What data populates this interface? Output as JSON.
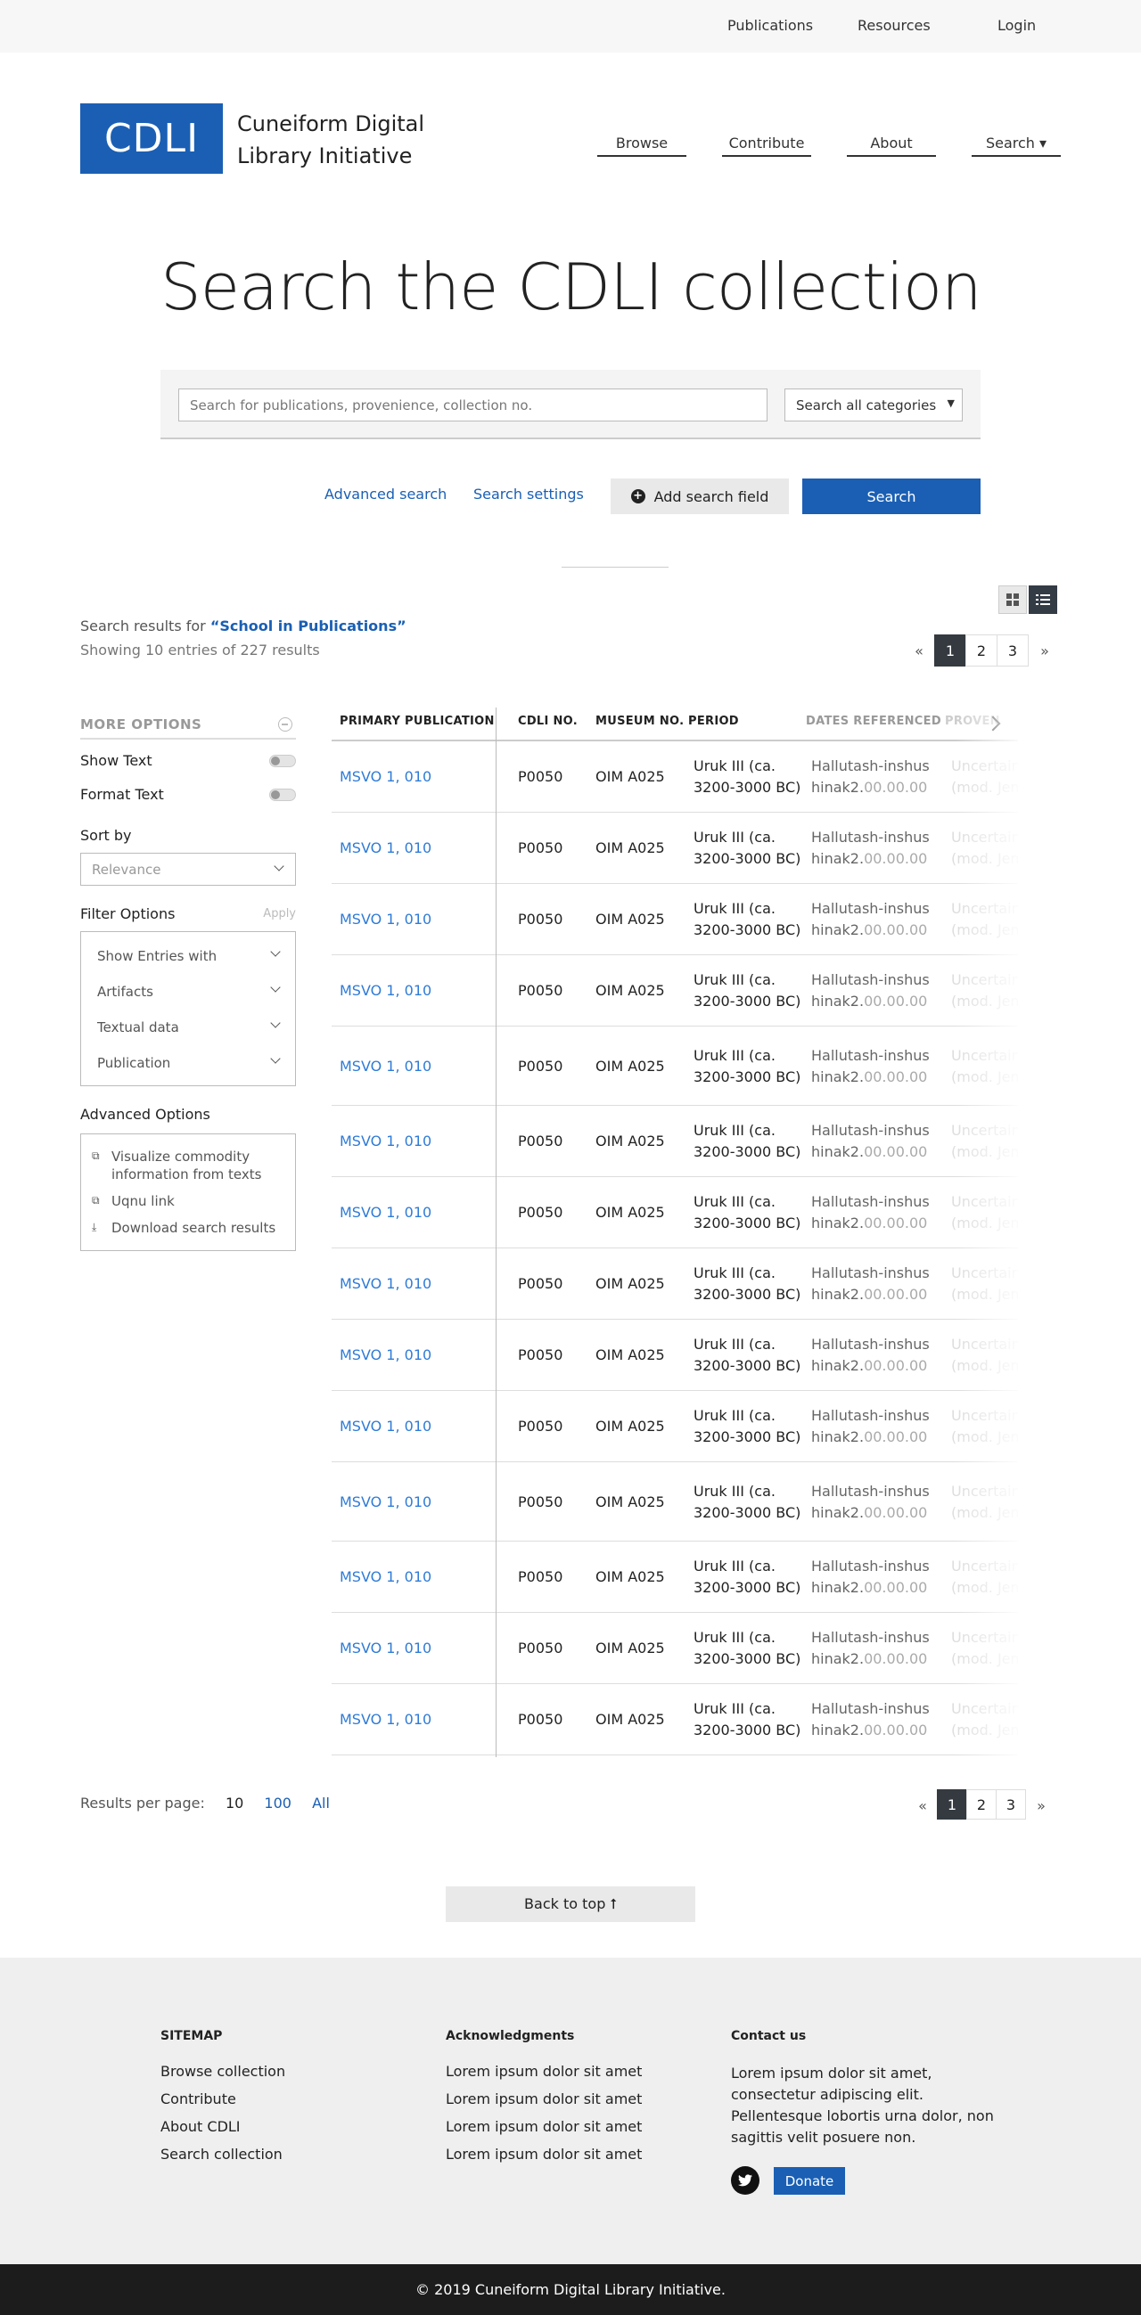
{
  "topbar": {
    "publications": "Publications",
    "resources": "Resources",
    "login": "Login"
  },
  "brand": {
    "logo": "CDLI",
    "name_line1": "Cuneiform Digital",
    "name_line2": "Library Initiative"
  },
  "nav": {
    "browse": "Browse",
    "contribute": "Contribute",
    "about": "About",
    "search": "Search ▾"
  },
  "page_title": "Search the CDLI collection",
  "search": {
    "placeholder": "Search for publications, provenience, collection no.",
    "category": "Search all categories",
    "advanced": "Advanced search",
    "settings": "Search settings",
    "add_field": "Add search field",
    "button": "Search"
  },
  "results": {
    "prefix": "Search results for ",
    "query": "“School in Publications”",
    "showing": "Showing 10 entries of 227 results"
  },
  "pagination": {
    "prev": "«",
    "pages": [
      "1",
      "2",
      "3"
    ],
    "next": "»"
  },
  "sidebar": {
    "more_options": "MORE OPTIONS",
    "show_text": "Show Text",
    "format_text": "Format Text",
    "sort_by": "Sort by",
    "sort_value": "Relevance",
    "filter_options": "Filter Options",
    "apply": "Apply",
    "filters": [
      "Show Entries with",
      "Artifacts",
      "Textual data",
      "Publication"
    ],
    "advanced_options": "Advanced Options",
    "advanced_items": [
      "Visualize commodity information from texts",
      "Uqnu link",
      "Download search results"
    ]
  },
  "table": {
    "headers": [
      "PRIMARY PUBLICATION",
      "CDLI NO.",
      "MUSEUM NO.",
      "PERIOD",
      "DATES REFERENCED",
      "PROVEN"
    ],
    "row": {
      "pub": "MSVO 1, 010",
      "cdli": "P0050",
      "museum": "OIM A025",
      "period_1": "Uruk III (ca.",
      "period_2": "3200-3000 BC)",
      "date_1": "Hallutash-inshus",
      "date_2a": "hinak2.",
      "date_2b": "00.00.00",
      "prov_1": "Uncertain",
      "prov_2": "(mod. Jem"
    }
  },
  "rpp": {
    "label": "Results per page:",
    "options": [
      "10",
      "100",
      "All"
    ]
  },
  "back_to_top": "Back to top ⭡",
  "footer": {
    "sitemap": "SITEMAP",
    "sitemap_links": [
      "Browse collection",
      "Contribute",
      "About CDLI",
      "Search collection"
    ],
    "ack": "Acknowledgments",
    "ack_links": [
      "Lorem ipsum dolor sit amet",
      "Lorem ipsum dolor sit amet",
      "Lorem ipsum dolor sit amet",
      "Lorem ipsum dolor sit amet"
    ],
    "contact": "Contact us",
    "contact_text": "Lorem ipsum dolor sit amet, consectetur adipiscing elit. Pellentesque lobortis urna dolor, non sagittis velit posuere non.",
    "donate": "Donate"
  },
  "copyright": "© 2019 Cuneiform Digital Library Initiative.",
  "colors": {
    "brand": "#1a5fb4",
    "link": "#2f7bd6",
    "dark": "#343a40"
  }
}
